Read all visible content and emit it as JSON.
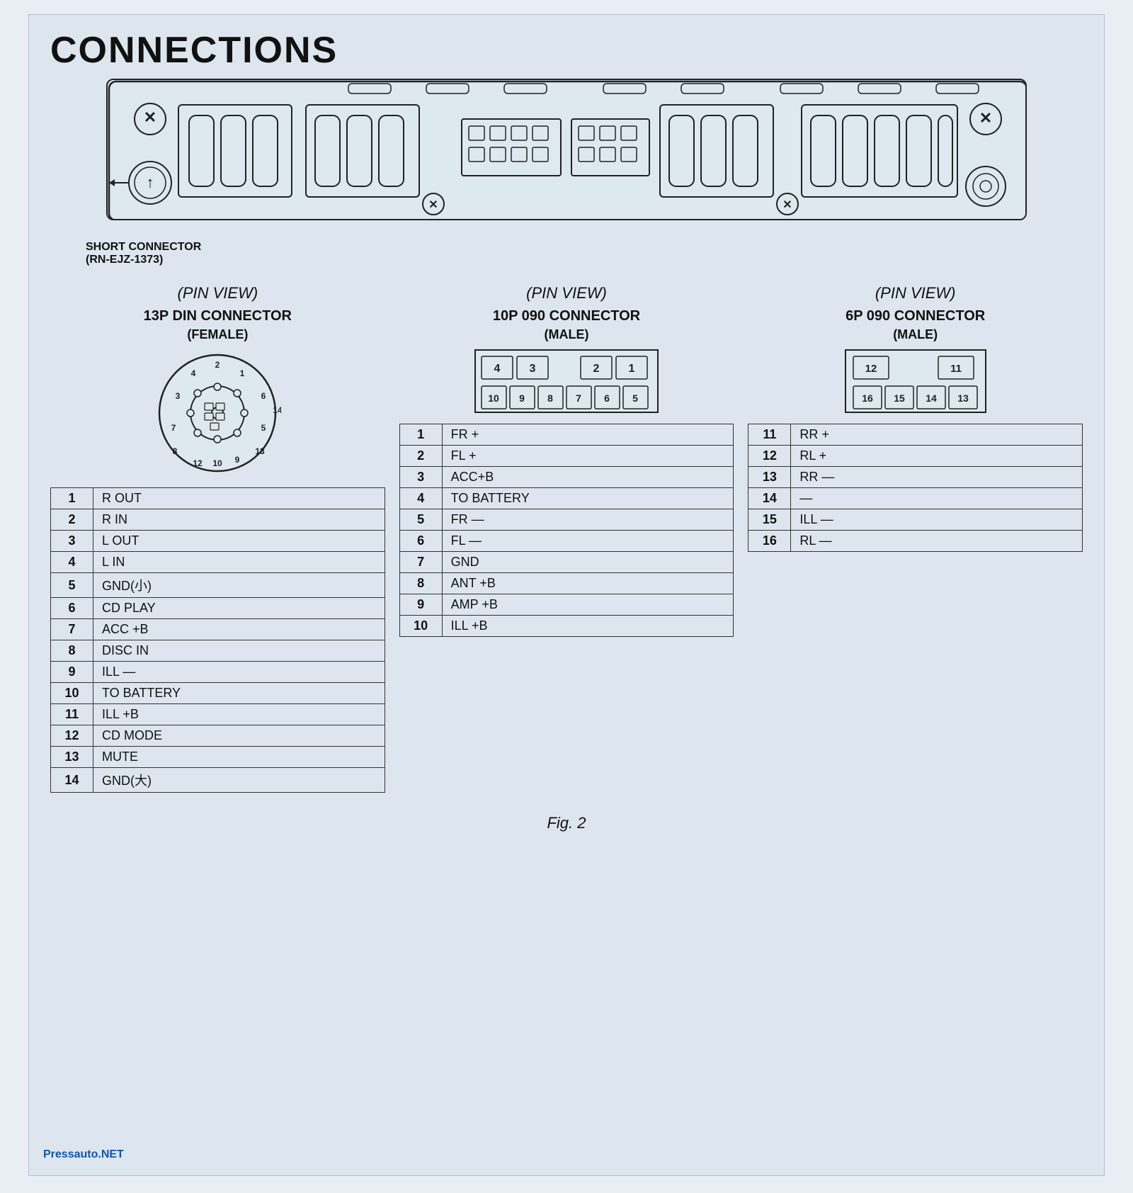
{
  "page": {
    "title": "CONNECTIONS",
    "fig_label": "Fig. 2",
    "watermark": "Pressauto.NET",
    "short_connector": {
      "label_line1": "SHORT CONNECTOR",
      "label_line2": "(RN-EJZ-1373)"
    }
  },
  "pin_views": [
    {
      "id": "13p",
      "view_label": "(PIN  VIEW)",
      "connector_title": "13P DIN CONNECTOR",
      "connector_subtitle": "(FEMALE)",
      "rows": [
        {
          "pin": "1",
          "signal": "R OUT"
        },
        {
          "pin": "2",
          "signal": "R IN"
        },
        {
          "pin": "3",
          "signal": "L OUT"
        },
        {
          "pin": "4",
          "signal": "L IN"
        },
        {
          "pin": "5",
          "signal": "GND(小)"
        },
        {
          "pin": "6",
          "signal": "CD PLAY"
        },
        {
          "pin": "7",
          "signal": "ACC +B"
        },
        {
          "pin": "8",
          "signal": "DISC IN"
        },
        {
          "pin": "9",
          "signal": "ILL —"
        },
        {
          "pin": "10",
          "signal": "TO BATTERY"
        },
        {
          "pin": "11",
          "signal": "ILL +B"
        },
        {
          "pin": "12",
          "signal": "CD MODE"
        },
        {
          "pin": "13",
          "signal": "MUTE"
        },
        {
          "pin": "14",
          "signal": "GND(大)"
        }
      ]
    },
    {
      "id": "10p",
      "view_label": "(PIN  VIEW)",
      "connector_title": "10P 090 CONNECTOR",
      "connector_subtitle": "(MALE)",
      "top_row": [
        "4",
        "3",
        "",
        "2",
        "1"
      ],
      "bottom_row": [
        "10",
        "9",
        "8",
        "7",
        "6",
        "5"
      ],
      "rows": [
        {
          "pin": "1",
          "signal": "FR +"
        },
        {
          "pin": "2",
          "signal": "FL +"
        },
        {
          "pin": "3",
          "signal": "ACC+B"
        },
        {
          "pin": "4",
          "signal": "TO BATTERY"
        },
        {
          "pin": "5",
          "signal": "FR —"
        },
        {
          "pin": "6",
          "signal": "FL —"
        },
        {
          "pin": "7",
          "signal": "GND"
        },
        {
          "pin": "8",
          "signal": "ANT +B"
        },
        {
          "pin": "9",
          "signal": "AMP +B"
        },
        {
          "pin": "10",
          "signal": "ILL +B"
        }
      ]
    },
    {
      "id": "6p",
      "view_label": "(PIN  VIEW)",
      "connector_title": "6P 090 CONNECTOR",
      "connector_subtitle": "(MALE)",
      "top_row": [
        "12",
        "",
        "11"
      ],
      "bottom_row": [
        "16",
        "15",
        "14",
        "13"
      ],
      "rows": [
        {
          "pin": "11",
          "signal": "RR +"
        },
        {
          "pin": "12",
          "signal": "RL +"
        },
        {
          "pin": "13",
          "signal": "RR —"
        },
        {
          "pin": "14",
          "signal": "—"
        },
        {
          "pin": "15",
          "signal": "ILL —"
        },
        {
          "pin": "16",
          "signal": "RL —"
        }
      ]
    }
  ]
}
